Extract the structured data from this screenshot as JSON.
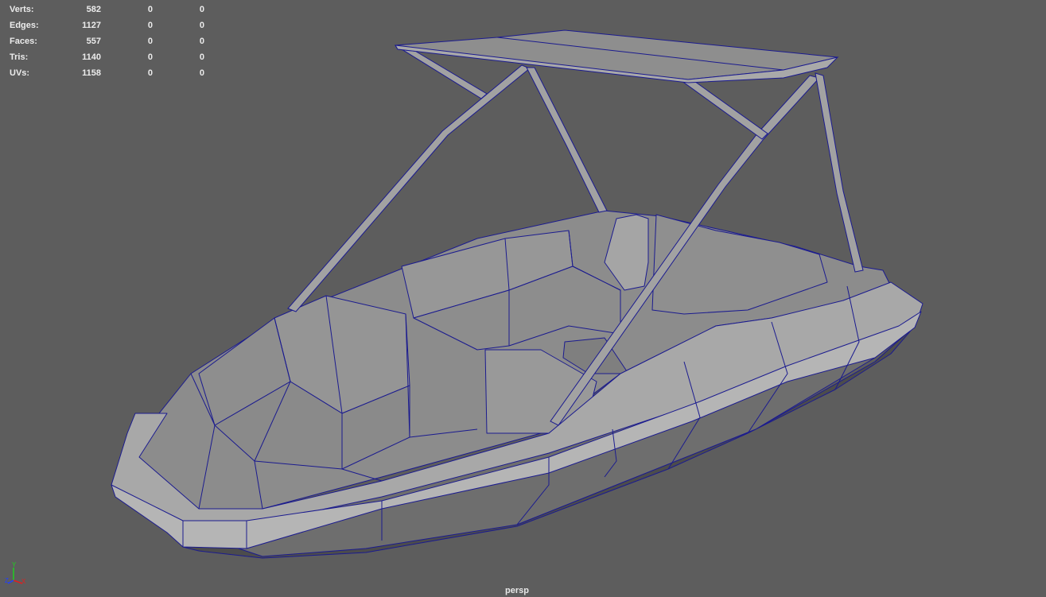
{
  "heads_up": {
    "rows": [
      {
        "label": "Verts:",
        "values": [
          "582",
          "0",
          "0"
        ]
      },
      {
        "label": "Edges:",
        "values": [
          "1127",
          "0",
          "0"
        ]
      },
      {
        "label": "Faces:",
        "values": [
          "557",
          "0",
          "0"
        ]
      },
      {
        "label": "Tris:",
        "values": [
          "1140",
          "0",
          "0"
        ]
      },
      {
        "label": "UVs:",
        "values": [
          "1158",
          "0",
          "0"
        ]
      }
    ]
  },
  "camera_label": "persp",
  "axis": {
    "x": "X",
    "y": "Y",
    "z": "Z"
  },
  "colors": {
    "background": "#5d5d5d",
    "wireframe": "#1b1b8f",
    "surface": "#9a9a9a",
    "x": "#e02020",
    "y": "#20d020",
    "z": "#2040ff"
  }
}
